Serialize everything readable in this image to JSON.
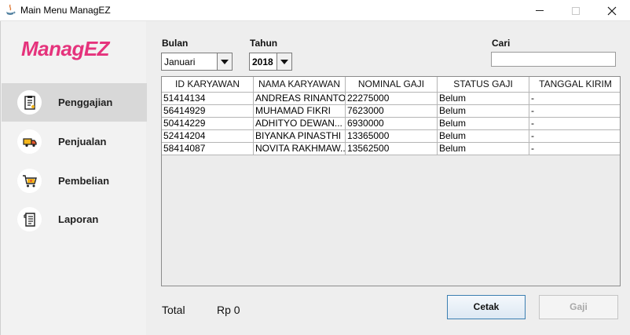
{
  "window": {
    "title": "Main Menu ManagEZ"
  },
  "sidebar": {
    "logo": "ManagEZ",
    "logo_color": "#e5337c",
    "items": [
      {
        "label": "Penggajian",
        "icon": "payroll-document-icon",
        "active": true
      },
      {
        "label": "Penjualan",
        "icon": "delivery-truck-icon",
        "active": false
      },
      {
        "label": "Pembelian",
        "icon": "shopping-cart-icon",
        "active": false
      },
      {
        "label": "Laporan",
        "icon": "report-receipt-icon",
        "active": false
      }
    ]
  },
  "filters": {
    "bulan_label": "Bulan",
    "bulan_value": "Januari",
    "tahun_label": "Tahun",
    "tahun_value": "2018",
    "cari_label": "Cari",
    "cari_value": ""
  },
  "table": {
    "columns": [
      "ID KARYAWAN",
      "NAMA KARYAWAN",
      "NOMINAL GAJI",
      "STATUS GAJI",
      "TANGGAL KIRIM"
    ],
    "rows": [
      [
        "51414134",
        "ANDREAS RINANTO",
        "22275000",
        "Belum",
        "-"
      ],
      [
        "56414929",
        "MUHAMAD FIKRI",
        "7623000",
        "Belum",
        "-"
      ],
      [
        "50414229",
        "ADHITYO DEWAN...",
        "6930000",
        "Belum",
        "-"
      ],
      [
        "52414204",
        "BIYANKA PINASTHI",
        "13365000",
        "Belum",
        "-"
      ],
      [
        "58414087",
        "NOVITA RAKHMAW...",
        "13562500",
        "Belum",
        "-"
      ]
    ]
  },
  "footer": {
    "total_label": "Total",
    "total_value": "Rp 0",
    "cetak_label": "Cetak",
    "gaji_label": "Gaji"
  }
}
